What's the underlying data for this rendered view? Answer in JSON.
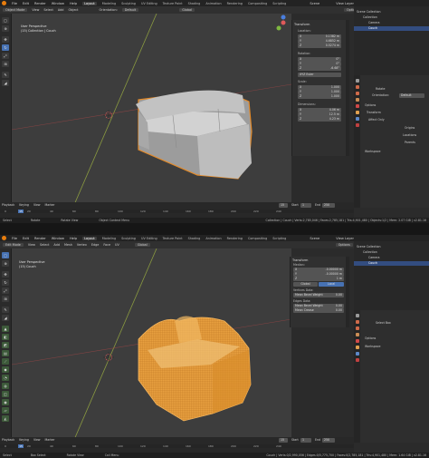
{
  "top": {
    "menus": [
      "File",
      "Edit",
      "Render",
      "Window",
      "Help"
    ],
    "tabs": [
      "Layout",
      "Modeling",
      "Sculpting",
      "UV Editing",
      "Texture Paint",
      "Shading",
      "Animation",
      "Rendering",
      "Compositing",
      "Scripting"
    ],
    "active_tab": "Layout",
    "scene_label": "Scene",
    "view_layer_label": "View Layer"
  },
  "panel1": {
    "mode": "Object Mode",
    "header_menus": [
      "View",
      "Select",
      "Add",
      "Object"
    ],
    "orientation_label": "Orientation:",
    "orientation_value": "Default",
    "pivot": "Global",
    "options": "Options",
    "view_title": "User Perspective",
    "view_sub": "(15) Collection | Couch",
    "npanel": {
      "transform_title": "Transform",
      "location_label": "Location:",
      "location": [
        [
          "X",
          "0.1382 m"
        ],
        [
          "Y",
          "4.6852 m"
        ],
        [
          "Z",
          "0.5274 m"
        ]
      ],
      "rotation_label": "Rotation:",
      "rotation": [
        [
          "X",
          "0°"
        ],
        [
          "Y",
          "0°"
        ],
        [
          "Z",
          "-6.68°"
        ]
      ],
      "mode_label": "XYZ Euler",
      "scale_label": "Scale:",
      "scale": [
        [
          "X",
          "1.000"
        ],
        [
          "Y",
          "1.000"
        ],
        [
          "Z",
          "1.000"
        ]
      ],
      "dimensions_label": "Dimensions:",
      "dimensions": [
        [
          "X",
          "4.06 m"
        ],
        [
          "Y",
          "12.5 m"
        ],
        [
          "Z",
          "4.23 m"
        ]
      ]
    },
    "outliner": {
      "title": "Scene Collection",
      "rows": [
        "Collection",
        "Camera",
        "Couch"
      ],
      "selected": "Couch"
    },
    "properties": {
      "tool": "Rotate",
      "orientation_label": "Orientation:",
      "orientation_value": "Default",
      "options": "Options",
      "transform": "Transform",
      "affect_only": "Affect Only",
      "origins": "Origins",
      "locations": "Locations",
      "parents": "Parents",
      "workspace": "Workspace"
    },
    "timeline": {
      "menus": [
        "Playback",
        "Keying",
        "View",
        "Marker"
      ],
      "current_frame": "15",
      "start_label": "Start",
      "start": "1",
      "end_label": "End",
      "end": "250",
      "ticks": [
        "0",
        "20",
        "40",
        "60",
        "80",
        "100",
        "120",
        "140",
        "160",
        "180",
        "200",
        "220",
        "240"
      ]
    },
    "status": {
      "select": "Select",
      "rotate": "Rotate",
      "rotate_view": "Rotate View",
      "context": "Object Context Menu",
      "info": "Collection | Couch | Verts:2,785,046 | Faces:2,785,181 | Tris:4,901,480 | Objects:1/2 | Mem: 2.07 GiB | v2.81.16"
    }
  },
  "panel2": {
    "mode": "Edit Mode",
    "header_menus": [
      "View",
      "Select",
      "Add",
      "Mesh",
      "Vertex",
      "Edge",
      "Face",
      "UV"
    ],
    "pivot": "Global",
    "options": "Options",
    "view_title": "User Perspective",
    "view_sub": "(15) Couch",
    "npanel": {
      "transform_title": "Transform",
      "median_label": "Median:",
      "median": [
        [
          "X",
          "-0.00000 m"
        ],
        [
          "Y",
          "-0.00000 m"
        ],
        [
          "Z",
          "1 m"
        ]
      ],
      "global_label": "Global",
      "local_label": "Local",
      "vertices_data": "Vertices Data:",
      "mean_bevel_weight": "Mean Bevel Weight",
      "mean_bevel_value": "0.00",
      "edges_data": "Edges Data:",
      "edge_bevel_value": "0.00",
      "mean_crease": "Mean Crease",
      "mean_crease_value": "0.00"
    },
    "outliner": {
      "title": "Scene Collection",
      "rows": [
        "Collection",
        "Camera",
        "Couch"
      ],
      "selected": "Couch"
    },
    "properties": {
      "tool": "Select Box",
      "options": "Options",
      "workspace": "Workspace"
    },
    "timeline": {
      "menus": [
        "Playback",
        "Keying",
        "View",
        "Marker"
      ],
      "current_frame": "15",
      "start_label": "Start",
      "start": "1",
      "end_label": "End",
      "end": "250",
      "ticks": [
        "0",
        "20",
        "40",
        "60",
        "80",
        "100",
        "120",
        "140",
        "160",
        "180",
        "200",
        "220",
        "240"
      ]
    },
    "status": {
      "select": "Select",
      "box_select": "Box Select",
      "rotate_view": "Rotate View",
      "context": "Call Menu",
      "info": "Couch | Verts:0/2,990,056 | Edges:0/5,775,700 | Faces:0/2,785,181 | Tris:4,901,480 | Mem: 1.64 GiB | v2.81.16"
    }
  },
  "colors": {
    "accent": "#4772b3",
    "selection": "#f5a23a",
    "viewport": "#3d3d3d",
    "couch_gray": "#b9b9b9"
  }
}
